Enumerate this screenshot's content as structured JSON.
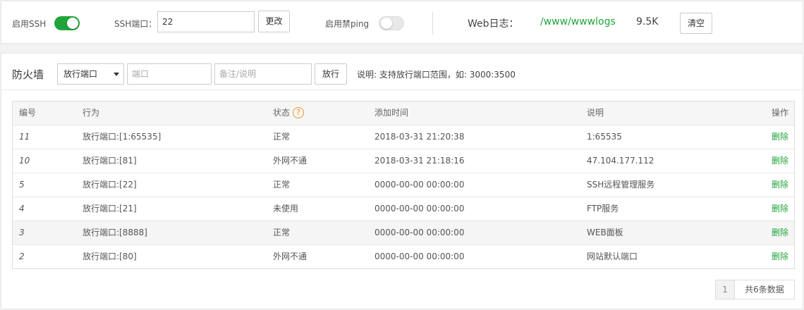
{
  "ssh": {
    "enable_label": "启用SSH",
    "enabled": true,
    "port_label": "SSH端口：",
    "port_value": "22",
    "change_label": "更改",
    "ping_label": "启用禁ping",
    "ping_enabled": false
  },
  "weblog": {
    "label": "Web日志：",
    "path": "/www/wwwlogs",
    "size": "9.5K",
    "clear_label": "清空"
  },
  "firewall": {
    "title": "防火墙",
    "type_selected": "放行端口",
    "port_placeholder": "端口",
    "note_placeholder": "备注/说明",
    "allow_label": "放行",
    "hint": "说明: 支持放行端口范围，如: 3000:3500",
    "columns": {
      "id": "编号",
      "action": "行为",
      "status": "状态",
      "time": "添加时间",
      "desc": "说明",
      "op": "操作"
    },
    "status_help_icon": "question-circle-icon",
    "rows": [
      {
        "id": "11",
        "action": "放行端口:[1:65535]",
        "status": "正常",
        "time": "2018-03-31 21:20:38",
        "desc": "1:65535",
        "op": "删除"
      },
      {
        "id": "10",
        "action": "放行端口:[81]",
        "status": "外网不通",
        "time": "2018-03-31 21:18:16",
        "desc": "47.104.177.112",
        "op": "删除"
      },
      {
        "id": "5",
        "action": "放行端口:[22]",
        "status": "正常",
        "time": "0000-00-00 00:00:00",
        "desc": "SSH远程管理服务",
        "op": "删除"
      },
      {
        "id": "4",
        "action": "放行端口:[21]",
        "status": "未使用",
        "time": "0000-00-00 00:00:00",
        "desc": "FTP服务",
        "op": "删除"
      },
      {
        "id": "3",
        "action": "放行端口:[8888]",
        "status": "正常",
        "time": "0000-00-00 00:00:00",
        "desc": "WEB面板",
        "op": "删除"
      },
      {
        "id": "2",
        "action": "放行端口:[80]",
        "status": "外网不通",
        "time": "0000-00-00 00:00:00",
        "desc": "网站默认端口",
        "op": "删除"
      }
    ],
    "pager": {
      "page": "1",
      "total": "共6条数据"
    }
  },
  "colors": {
    "accent": "#20a53a",
    "help": "#f0932b"
  }
}
